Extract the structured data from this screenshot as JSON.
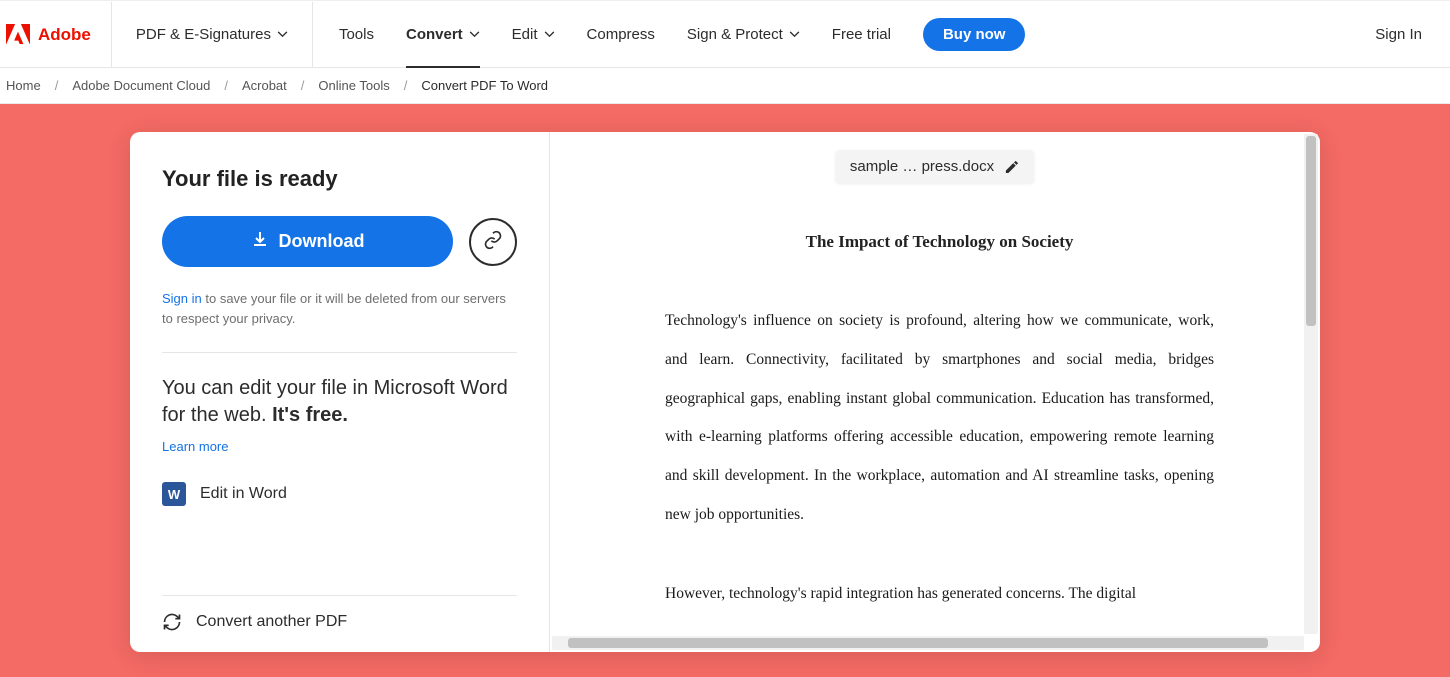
{
  "brand": "Adobe",
  "nav": {
    "pdf": "PDF & E-Signatures",
    "tools": "Tools",
    "convert": "Convert",
    "edit": "Edit",
    "compress": "Compress",
    "sign": "Sign & Protect",
    "trial": "Free trial",
    "buy": "Buy now",
    "signin": "Sign In"
  },
  "crumbs": {
    "home": "Home",
    "adc": "Adobe Document Cloud",
    "acrobat": "Acrobat",
    "online": "Online Tools",
    "current": "Convert PDF To Word"
  },
  "left": {
    "ready": "Your file is ready",
    "download": "Download",
    "signin": "Sign in",
    "note_rest": " to save your file or it will be deleted from our servers to respect your privacy.",
    "edit_a": "You can edit your file in Microsoft Word for the web. ",
    "edit_b": "It's free.",
    "learn": "Learn more",
    "editword": "Edit in Word",
    "convert": "Convert another PDF"
  },
  "right": {
    "filename": "sample … press.docx",
    "title": "The Impact of Technology on Society",
    "p1": "Technology's influence on society is profound, altering how we communicate, work, and learn. Connectivity, facilitated by smartphones and social media, bridges geographical gaps, enabling instant global communication. Education has transformed, with e-learning platforms offering accessible education, empowering remote learning and skill development. In the workplace, automation and AI streamline tasks, opening new job opportunities.",
    "p2": "However, technology's rapid integration has generated concerns. The digital"
  }
}
